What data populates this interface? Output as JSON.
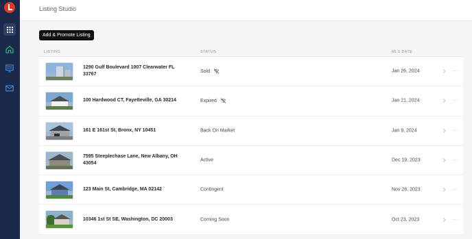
{
  "app": {
    "title": "Listing Studio"
  },
  "sidebar": {
    "logo": "brand-logo",
    "items": [
      {
        "id": "apps",
        "icon": "grid-icon",
        "active": true
      },
      {
        "id": "home",
        "icon": "home-icon",
        "active": false
      },
      {
        "id": "listings",
        "icon": "monitor-icon",
        "active": false
      },
      {
        "id": "mail",
        "icon": "mail-icon",
        "active": false
      }
    ]
  },
  "toolbar": {
    "add_label": "Add & Promote Listing"
  },
  "table": {
    "headers": {
      "listing": "LISTING",
      "status": "STATUS",
      "mls_date": "MLS DATE"
    },
    "rows": [
      {
        "address": "1290 Gulf Boulevard 1007 Clearwater FL 33767",
        "status": "Sold",
        "promo_off": true,
        "date": "Jan 26, 2024",
        "thumb": "highrise"
      },
      {
        "address": "100 Hardwood CT, Fayetteville, GA 30214",
        "status": "Expired",
        "promo_off": true,
        "date": "Jan 21, 2024",
        "thumb": "white-house"
      },
      {
        "address": "161 E 161st St, Bronx, NY 10451",
        "status": "Back On Market",
        "promo_off": false,
        "date": "Jan 9, 2024",
        "thumb": "gray-house"
      },
      {
        "address": "7595 Steeplechase Lane, New Albany, OH 43054",
        "status": "Active",
        "promo_off": false,
        "date": "Dec 19, 2023",
        "thumb": "stone-house"
      },
      {
        "address": "123 Main St, Cambridge, MA 02142",
        "status": "Contingent",
        "promo_off": false,
        "date": "Nov 28, 2023",
        "thumb": "blue-house"
      },
      {
        "address": "10346 1st St SE, Washington, DC 20003",
        "status": "Coming Soon",
        "promo_off": false,
        "date": "Oct 23, 2023",
        "thumb": "garden-house"
      }
    ]
  },
  "colors": {
    "sidebar": "#1b2a4a",
    "brand": "#d93a2b",
    "nav_green": "#2fae6a",
    "nav_blue": "#4a90e2"
  }
}
